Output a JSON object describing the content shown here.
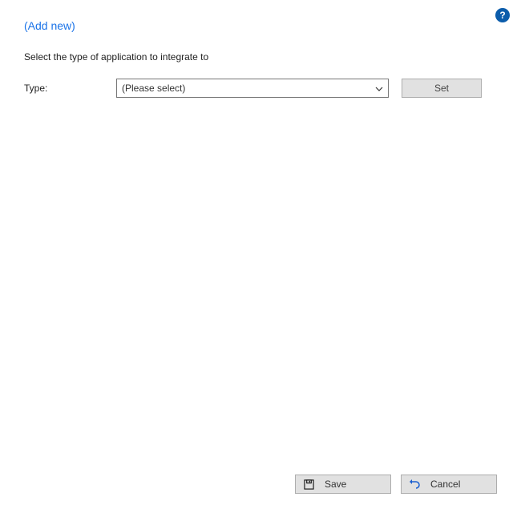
{
  "header": {
    "add_new_label": "(Add new)"
  },
  "instruction_text": "Select the type of application to integrate to",
  "form": {
    "type_label": "Type:",
    "type_selected": "(Please select)",
    "set_button_label": "Set"
  },
  "help": {
    "symbol": "?"
  },
  "footer": {
    "save_label": "Save",
    "cancel_label": "Cancel"
  },
  "icons": {
    "help_name": "help-icon",
    "save_name": "save-icon",
    "cancel_name": "undo-icon",
    "chevron_name": "chevron-down-icon"
  }
}
